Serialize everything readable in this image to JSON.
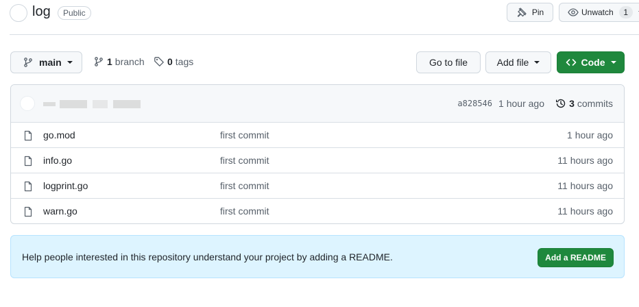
{
  "repo": {
    "name": "log",
    "visibility": "Public"
  },
  "header_actions": {
    "pin_label": "Pin",
    "watch_label": "Unwatch",
    "watch_count": "1"
  },
  "toolbar": {
    "branch_selector": "main",
    "branch_count": "1",
    "branch_word": "branch",
    "tag_count": "0",
    "tag_word": "tags",
    "go_to_file": "Go to file",
    "add_file": "Add file",
    "code": "Code"
  },
  "latest_commit": {
    "sha": "a828546",
    "time": "1 hour ago",
    "commit_count": "3",
    "commit_word": "commits"
  },
  "files": [
    {
      "name": "go.mod",
      "message": "first commit",
      "age": "1 hour ago"
    },
    {
      "name": "info.go",
      "message": "first commit",
      "age": "11 hours ago"
    },
    {
      "name": "logprint.go",
      "message": "first commit",
      "age": "11 hours ago"
    },
    {
      "name": "warn.go",
      "message": "first commit",
      "age": "11 hours ago"
    }
  ],
  "readme_banner": {
    "text": "Help people interested in this repository understand your project by adding a README.",
    "button": "Add a README"
  },
  "colors": {
    "primary_green": "#1f883d",
    "banner_bg": "#ddf4ff",
    "banner_border": "#b6e3ff"
  }
}
